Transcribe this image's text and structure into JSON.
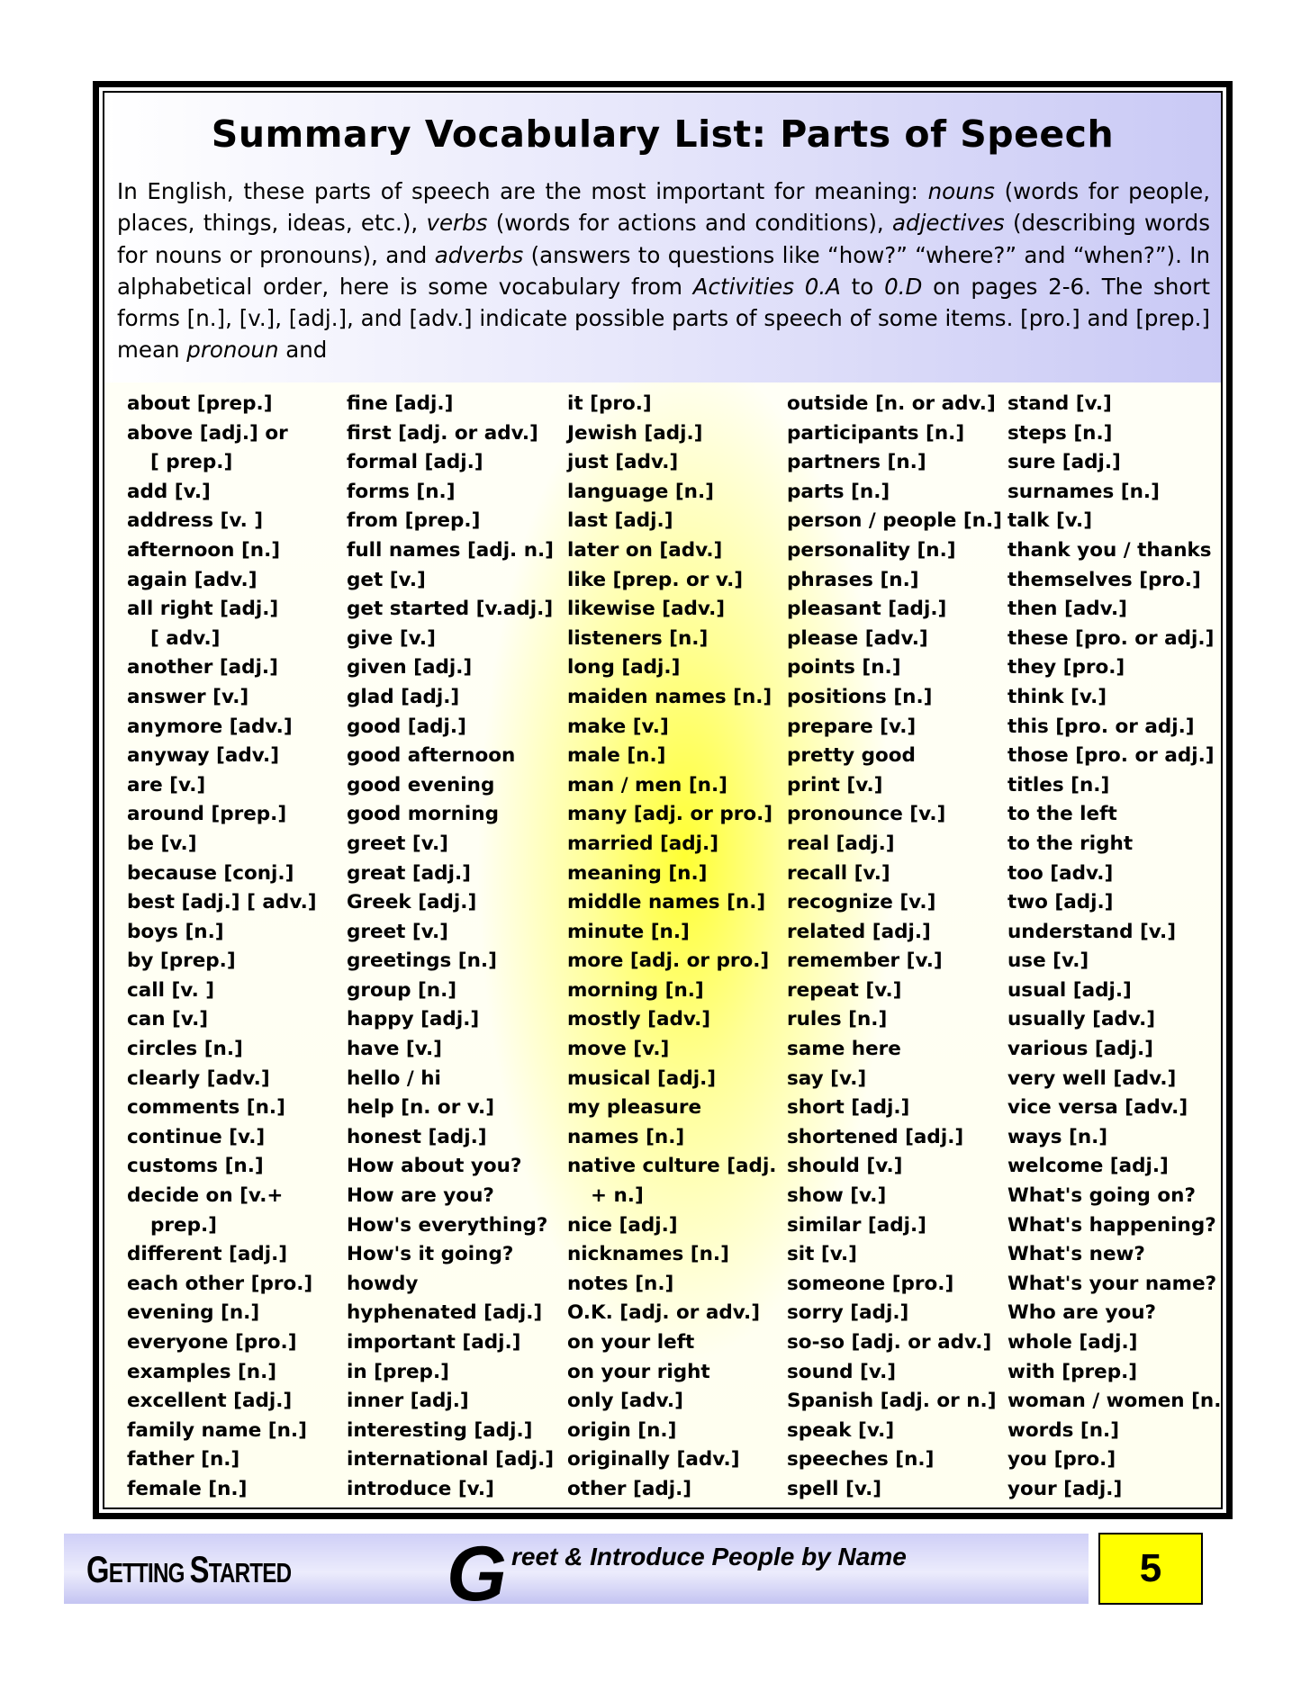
{
  "title": "Summary Vocabulary List: Parts of Speech",
  "intro": {
    "p1": "In English, these parts of speech are the most important for meaning: ",
    "nouns": "nouns",
    "p2": " (words for people, places, things, ideas, etc.), ",
    "verbs": "verbs",
    "p3": " (words for actions and conditions), ",
    "adjectives": "adjectives",
    "p4": " (describing words for nouns or pronouns), and ",
    "adverbs": "adverbs",
    "p5": " (answers to questions like “how?” “where?” and “when?”). In alphabetical order, here is some vocabulary from ",
    "activities": "Activities 0.A",
    "p6": " to ",
    "activity_end": "0.D",
    "p7": " on pages 2-6.  The short forms [n.], [v.], [adj.], and [adv.] indicate possible parts of speech of some items. [pro.] and [prep.] mean ",
    "pronoun": "pronoun",
    "p8": " and"
  },
  "columns": [
    [
      "about [prep.]",
      "above [adj.] or",
      "  [ prep.]",
      "add [v.]",
      "address [v. ]",
      "afternoon [n.]",
      "again [adv.]",
      "all right [adj.]",
      "  [ adv.]",
      "another [adj.]",
      "answer [v.]",
      "anymore [adv.]",
      "anyway [adv.]",
      "are [v.]",
      "around [prep.]",
      "be [v.]",
      "because [conj.]",
      "best [adj.] [ adv.]",
      "boys [n.]",
      "by [prep.]",
      "call [v. ]",
      "can [v.]",
      "circles [n.]",
      "clearly [adv.]",
      "comments [n.]",
      "continue [v.]",
      "customs [n.]",
      "decide on [v.+",
      "  prep.]",
      "different [adj.]",
      "each other [pro.]",
      "evening [n.]",
      "everyone [pro.]",
      "examples [n.]",
      "excellent [adj.]",
      "family name [n.]",
      "father [n.]",
      "female [n.]"
    ],
    [
      "fine [adj.]",
      "first [adj. or adv.]",
      "formal [adj.]",
      "forms [n.]",
      "from [prep.]",
      "full names [adj. n.]",
      "get [v.]",
      "get started [v.adj.]",
      "give [v.]",
      "given [adj.]",
      "glad [adj.]",
      "good [adj.]",
      "good afternoon",
      "good evening",
      "good morning",
      "greet [v.]",
      "great [adj.]",
      "Greek [adj.]",
      "greet [v.]",
      "greetings [n.]",
      "group [n.]",
      "happy [adj.]",
      "have [v.]",
      "hello / hi",
      "help [n. or v.]",
      "honest [adj.]",
      "How about you?",
      "How are you?",
      "How's everything?",
      "How's it going?",
      "howdy",
      "hyphenated [adj.]",
      "important [adj.]",
      "in [prep.]",
      "inner [adj.]",
      "interesting [adj.]",
      "international [adj.]",
      "introduce [v.]"
    ],
    [
      "it [pro.]",
      "Jewish [adj.]",
      "just [adv.]",
      "language [n.]",
      "last [adj.]",
      "later on [adv.]",
      "like [prep. or v.]",
      "likewise [adv.]",
      "listeners [n.]",
      "long [adj.]",
      "maiden names [n.]",
      "make [v.]",
      "male [n.]",
      "man / men [n.]",
      "many [adj. or pro.]",
      "married [adj.]",
      "meaning [n.]",
      "middle names [n.]",
      "minute [n.]",
      "more [adj. or pro.]",
      "morning [n.]",
      "mostly [adv.]",
      "move [v.]",
      "musical [adj.]",
      "my pleasure",
      "names [n.]",
      "native culture [adj.",
      "  + n.]",
      "nice [adj.]",
      "nicknames [n.]",
      "notes [n.]",
      "O.K. [adj. or adv.]",
      "on your left",
      "on your right",
      "only [adv.]",
      "origin [n.]",
      "originally [adv.]",
      "other [adj.]"
    ],
    [
      "outside [n. or adv.]",
      "participants [n.]",
      "partners [n.]",
      "parts [n.]",
      "person / people [n.]",
      "personality [n.]",
      "phrases [n.]",
      "pleasant [adj.]",
      "please [adv.]",
      "points [n.]",
      "positions [n.]",
      "prepare [v.]",
      "pretty good",
      "print [v.]",
      "pronounce [v.]",
      "real [adj.]",
      "recall [v.]",
      "recognize [v.]",
      "related [adj.]",
      "remember [v.]",
      "repeat [v.]",
      "rules [n.]",
      "same here",
      "say [v.]",
      "short [adj.]",
      "shortened [adj.]",
      "should [v.]",
      "show [v.]",
      "similar [adj.]",
      "sit [v.]",
      "someone [pro.]",
      "sorry [adj.]",
      "so-so [adj. or adv.]",
      "sound [v.]",
      "Spanish [adj. or n.]",
      "speak [v.]",
      "speeches [n.]",
      "spell [v.]"
    ],
    [
      "stand [v.]",
      "steps [n.]",
      "sure [adj.]",
      "surnames [n.]",
      "talk [v.]",
      "thank you / thanks",
      "themselves [pro.]",
      "then [adv.]",
      "these [pro. or adj.]",
      "they [pro.]",
      "think [v.]",
      "this [pro. or adj.]",
      "those [pro. or adj.]",
      "titles [n.]",
      "to the left",
      "to the right",
      "too [adv.]",
      "two [adj.]",
      "understand [v.]",
      "use [v.]",
      "usual [adj.]",
      "usually [adv.]",
      "various [adj.]",
      "very well [adv.]",
      "vice versa [adv.]",
      "ways [n.]",
      "welcome [adj.]",
      "What's going on?",
      "What's happening?",
      "What's new?",
      "What's your name?",
      "Who are you?",
      "whole [adj.]",
      "with [prep.]",
      "woman / women [n.]",
      "words [n.]",
      "you [pro.]",
      "your [adj.]"
    ]
  ],
  "footer": {
    "section_first_1": "G",
    "section_rest_1": "ETTING ",
    "section_first_2": "S",
    "section_rest_2": "TARTED",
    "lesson_initial": "G",
    "lesson_rest": "reet & Introduce People by Name",
    "page_number": "5"
  },
  "colors": {
    "header_gradient_end": "#c9c9f5",
    "highlight_yellow": "#ffff28",
    "page_box": "#ffff00",
    "footer_band": "#cfcff7"
  }
}
